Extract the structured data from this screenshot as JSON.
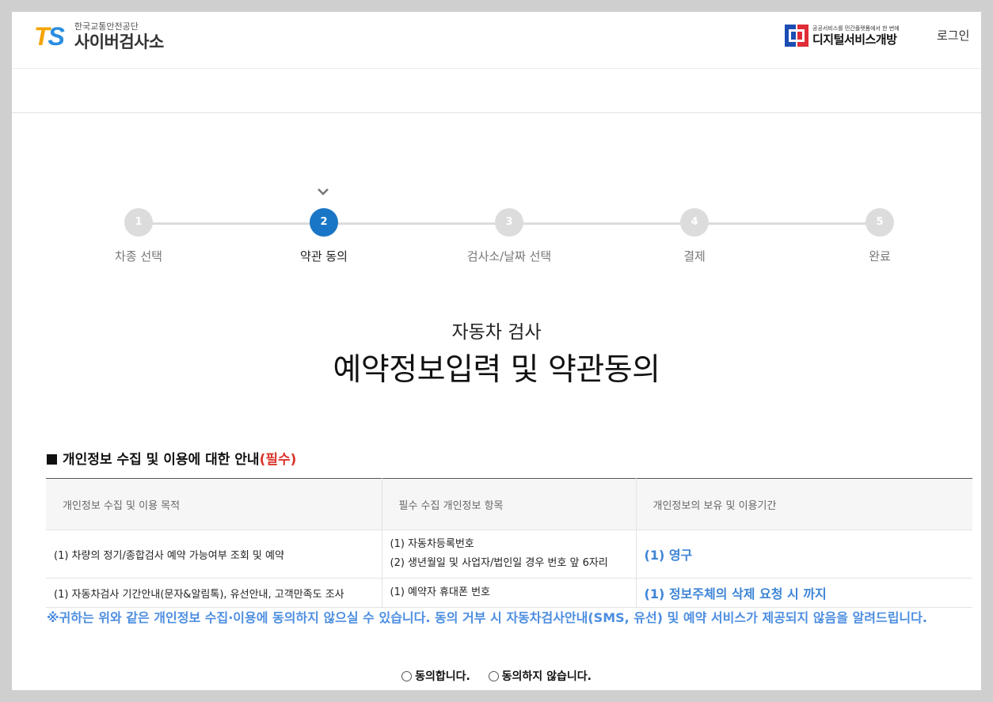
{
  "header": {
    "logo_letters": "TS",
    "logo_sub": "한국교통안전공단",
    "logo_main": "사이버검사소",
    "gov_sub": "공공서비스를 민간플랫폼에서 한 번에",
    "gov_main": "디지털서비스개방",
    "login_label": "로그인"
  },
  "steps": [
    {
      "num": "1",
      "label": "차종 선택"
    },
    {
      "num": "2",
      "label": "약관 동의"
    },
    {
      "num": "3",
      "label": "검사소/날짜 선택"
    },
    {
      "num": "4",
      "label": "결제"
    },
    {
      "num": "5",
      "label": "완료"
    }
  ],
  "active_step": "2",
  "title": {
    "sub": "자동차 검사",
    "main": "예약정보입력 및 약관동의"
  },
  "privacy": {
    "heading": "개인정보 수집 및 이용에 대한 안내",
    "required": "(필수)",
    "columns": [
      "개인정보 수집 및 이용 목적",
      "필수 수집 개인정보 항목",
      "개인정보의 보유 및 이용기간"
    ],
    "rows": [
      {
        "purpose": "(1) 차량의 정기/종합검사 예약 가능여부 조회 및 예약",
        "items": [
          "(1) 자동차등록번호",
          "(2) 생년월일 및 사업자/법인일 경우 번호 앞 6자리"
        ],
        "period": "(1) 영구"
      },
      {
        "purpose": "(1) 자동차검사 기간안내(문자&알림톡), 유선안내, 고객만족도 조사",
        "items": [
          "(1) 예약자 휴대폰 번호"
        ],
        "period": "(1) 정보주체의 삭제 요청 시 까지"
      }
    ],
    "notice": "※귀하는 위와 같은 개인정보 수집·이용에 동의하지 않으실 수 있습니다. 동의 거부 시 자동차검사안내(SMS, 유선) 및 예약 서비스가 제공되지 않음을 알려드립니다."
  },
  "agree": {
    "yes_label": "동의합니다.",
    "no_label": "동의하지 않습니다."
  },
  "colors": {
    "accent": "#1976c6",
    "notice": "#4d8ee0",
    "required": "#d9352b"
  }
}
